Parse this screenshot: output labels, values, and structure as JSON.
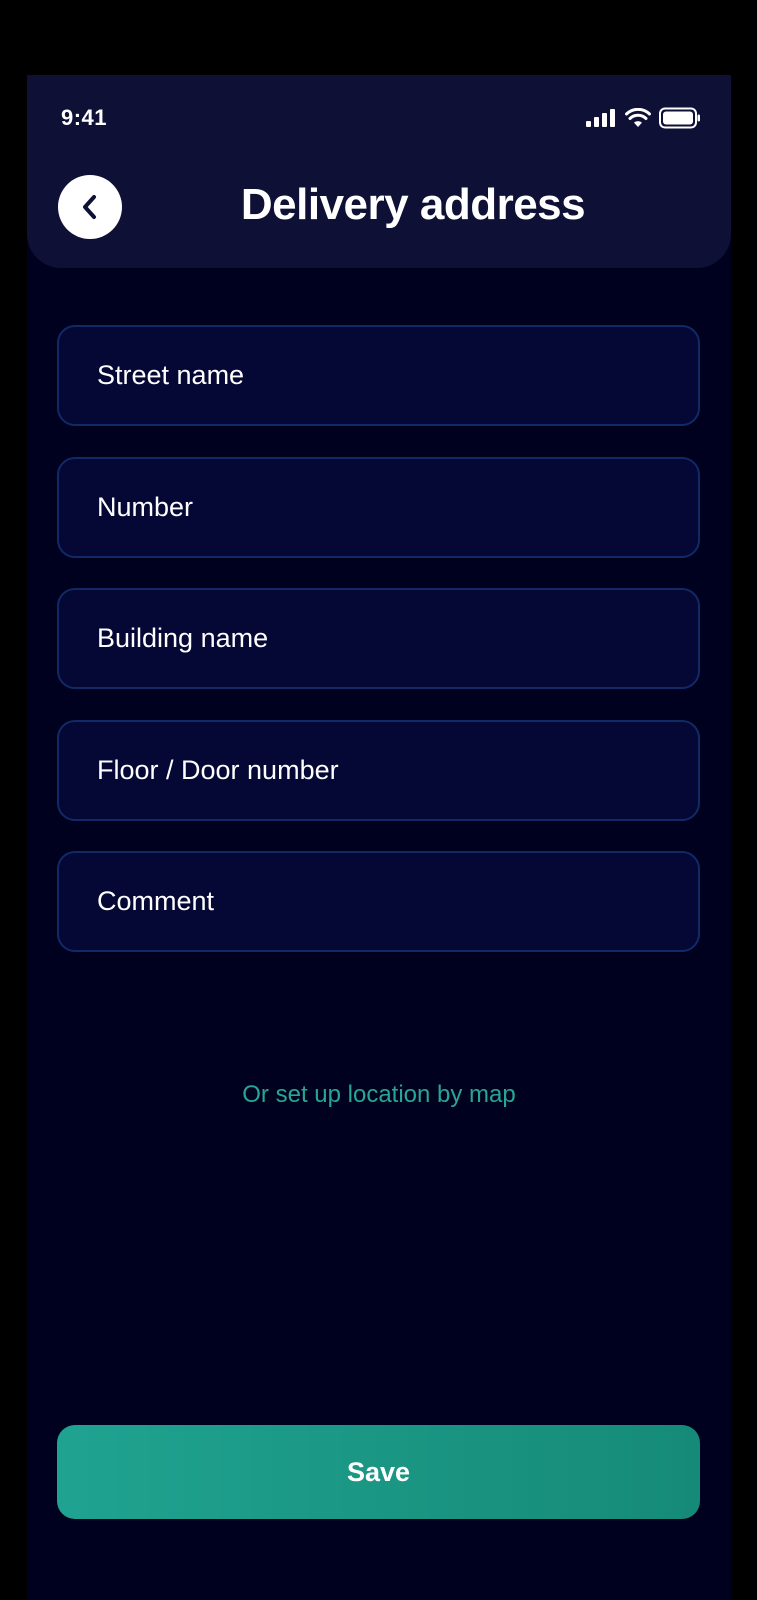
{
  "status_bar": {
    "time": "9:41",
    "icons": [
      "signal-icon",
      "wifi-icon",
      "battery-icon"
    ]
  },
  "header": {
    "title": "Delivery address",
    "back_icon": "chevron-left-icon"
  },
  "form": {
    "fields": [
      {
        "placeholder": "Street name",
        "value": ""
      },
      {
        "placeholder": "Number",
        "value": ""
      },
      {
        "placeholder": "Building name",
        "value": ""
      },
      {
        "placeholder": "Floor / Door number",
        "value": ""
      },
      {
        "placeholder": "Comment",
        "value": ""
      }
    ]
  },
  "map_link": {
    "label": "Or set up location by map"
  },
  "save_button": {
    "label": "Save"
  },
  "colors": {
    "background": "#00001f",
    "header": "#0f1036",
    "field_bg": "#050735",
    "field_border": "#112a66",
    "accent": "#27a693",
    "button": "#1a9886"
  }
}
